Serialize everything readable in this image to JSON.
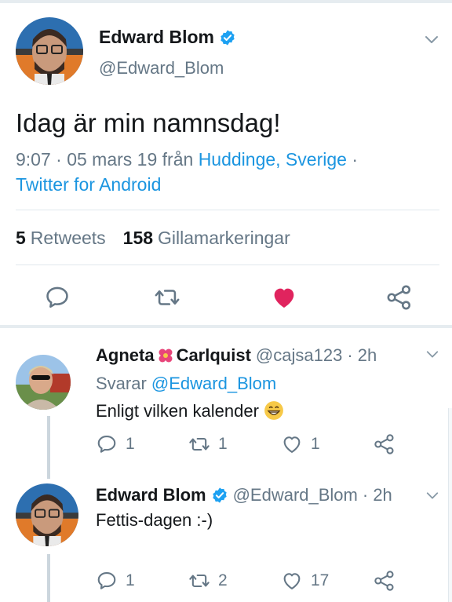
{
  "main_tweet": {
    "author_name": "Edward Blom",
    "author_handle": "@Edward_Blom",
    "text": "Idag är min namnsdag!",
    "time": "9:07 · 05 mars 19 från",
    "location": "Huddinge, Sverige",
    "separator": "·",
    "source": "Twitter for Android",
    "retweets_count": "5",
    "retweets_label": "Retweets",
    "likes_count": "158",
    "likes_label": "Gillamarkeringar",
    "liked": true,
    "icons": [
      "reply-icon",
      "retweet-icon",
      "like-icon",
      "share-icon"
    ]
  },
  "replies": [
    {
      "author_name_part1": "Agneta",
      "author_name_part2": "Carlquist",
      "author_handle": "@cajsa123",
      "time": "· 2h",
      "reply_to_prefix": "Svarar",
      "reply_to_handle": "@Edward_Blom",
      "text": "Enligt vilken kalender",
      "reply_count": "1",
      "retweet_count": "1",
      "like_count": "1"
    },
    {
      "author_name": "Edward Blom",
      "author_handle": "@Edward_Blom",
      "time": "· 2h",
      "text": "Fettis-dagen :-)",
      "reply_count": "1",
      "retweet_count": "2",
      "like_count": "17"
    }
  ],
  "colors": {
    "link": "#1b95e0",
    "muted": "#657786",
    "text": "#14171a",
    "like_red": "#e0245e",
    "verified_blue": "#1da1f2"
  }
}
